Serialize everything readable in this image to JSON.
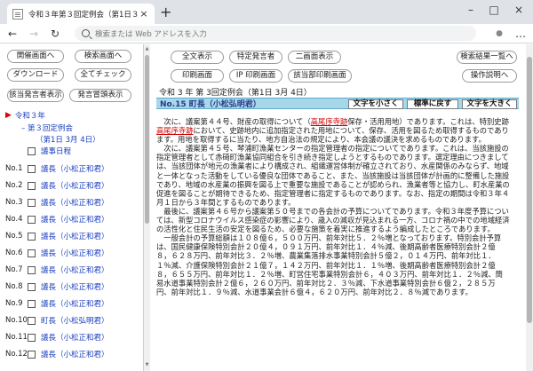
{
  "browser": {
    "tab_title": "令和３年第３回定例会（第1日３",
    "tab_close": "×",
    "new_tab": "+",
    "minimize": "–",
    "maximize": "□",
    "close": "×",
    "back": "←",
    "forward": "→",
    "reload": "↻",
    "address_placeholder": "検索または Web アドレスを入力",
    "menu": "…",
    "profile": "●"
  },
  "left": {
    "buttons": {
      "prev_meeting": "開催画面へ",
      "search_screen": "検索画面へ",
      "download": "ダウンロード",
      "check_all": "全てチェック",
      "speaker_display": "該当発言者表示",
      "speaker_list": "発言冒頭表示"
    },
    "tree_root": "令和３年",
    "tree_session": "第３回定例会",
    "tree_day": "（第1日 3月 4日）",
    "list_header": "議事日程",
    "rows": [
      {
        "no": "No.1",
        "text": "議長（小松正和君）"
      },
      {
        "no": "No.2",
        "text": "議長（小松正和君）"
      },
      {
        "no": "No.3",
        "text": "議長（小松正和君）"
      },
      {
        "no": "No.4",
        "text": "議長（小松正和君）"
      },
      {
        "no": "No.5",
        "text": "議長（小松正和君）"
      },
      {
        "no": "No.6",
        "text": "議長（小松正和君）"
      },
      {
        "no": "No.7",
        "text": "議長（小松正和君）"
      },
      {
        "no": "No.8",
        "text": "議長（小松正和君）"
      },
      {
        "no": "No.9",
        "text": "議長（小松正和君）"
      },
      {
        "no": "No.10",
        "text": "町長（小松弘明君）"
      },
      {
        "no": "No.11",
        "text": "議長（小松正和君）"
      },
      {
        "no": "No.12",
        "text": "議長（小松正和君）"
      }
    ]
  },
  "right": {
    "buttons": {
      "all_display": "全文表示",
      "specific_speaker": "特定発言者",
      "two_screen": "二画面表示",
      "results_list": "検索結果一覧へ",
      "print_screen": "印刷画面",
      "ip_print": "IP 印刷画面",
      "print_speaker": "該当部印刷画面",
      "operation": "操作説明へ"
    },
    "doc_title": "令和 3 年 第 3回定例会（第1日 3月 4日）",
    "speaker": "No.15 町長（小松弘明君）",
    "text_smaller": "文字を小さく",
    "text_reset": "標準に戻す",
    "text_larger": "文字を大きく",
    "para1_pre": "次に、議案第４４号、財産の取得について（",
    "para1_hl1": "高尾序寺跡",
    "para1_mid1": "保存・活用用地）であります。これは、特別史跡",
    "para1_hl2": "高尾序寺跡",
    "para1_post": "において、史跡地内に追加指定された用地について、保存、活用を図るため取得するものであります。用地を取得するに当たり、地方自治法の規定により、本会議の議決を求めるものであります。",
    "para2": "次に、議案第４５号、琴浦町漁業センターの指定管理者の指定についてであります。これは、当該施設の指定管理者として赤碕町漁業協同組合を引き続き指定しようとするものであります。選定理由につきましては、当該団体が地元の漁業者により構成され、組織運営体制が確立されており、水産関係のみならず、地域と一体となった活動をしている優良な団体であること、また、当該施設は当該団体が計画的に整備した施設であり、地域の水産業の振興を図る上で重要な施設であることが認められ、漁業者等と協力し、町水産業の促進を図ることが期待できるため、指定管理者に指定するものであります。なお、指定の期間は令和３年４月１日から３年間とするものであります。",
    "para3": "最後に、議案第４６号から議案第５０号までの各会計の予算についてであります。令和３年度予算については、新型コロナウイルス感染症の影響により、歳入の減収が見込まれる一方、コロナ禍の中での地域経済の活性化と住民生活の安定を図るため、必要な施策を着実に推進するよう編成したところであります。",
    "para4": "一般会計の予算総額は１０８億６，５００万円、前年対比５．２％増となっております。特別会計予算は、国民健康保険特別会計２０億４，０９１万円、前年対比１．４％減、後期高齢者医療特別会計２億８，６２８万円、前年対比３．２％増、農業集落排水事業特別会計５億２，０１４万円、前年対比１．１％減、介護保険特別会計２１億７，１４２万円、前年対比１．１％増、後期高齢者医療特別会計２億８，６５５万円、前年対比１．２％増、町営住宅事業特別会計６，４０３万円、前年対比１．２％減、簡易水道事業特別会計２億６，２６０万円、前年対比２．３％減、下水道事業特別会計６億２，２８５万円、前年対比１．９％減、水道事業会計６億４，６２０万円、前年対比２．８％減であります。"
  }
}
